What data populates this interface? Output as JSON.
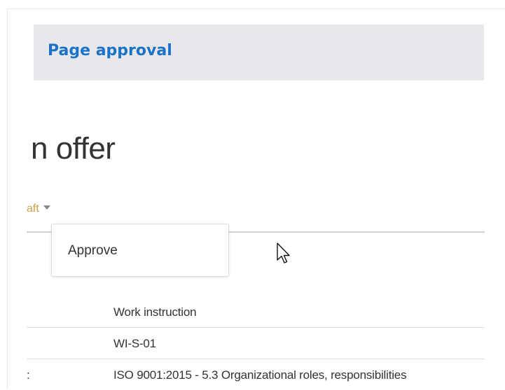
{
  "header": {
    "title": "Page approval"
  },
  "page": {
    "title_fragment": "n offer"
  },
  "status": {
    "label_fragment": "aft"
  },
  "menu": {
    "items": [
      {
        "label": "Approve"
      }
    ]
  },
  "properties": [
    {
      "label": "",
      "value": "Work instruction"
    },
    {
      "label": "",
      "value": "WI-S-01"
    },
    {
      "label": ":",
      "value": "ISO 9001:2015 - 5.3 Organizational roles, responsibilities"
    }
  ],
  "colors": {
    "header_title": "#1a73c8",
    "header_bg": "#e8e8ec",
    "status_text": "#c9a24a"
  },
  "icons": {
    "status_caret": "caret-down-icon",
    "pointer": "mouse-pointer-icon"
  }
}
